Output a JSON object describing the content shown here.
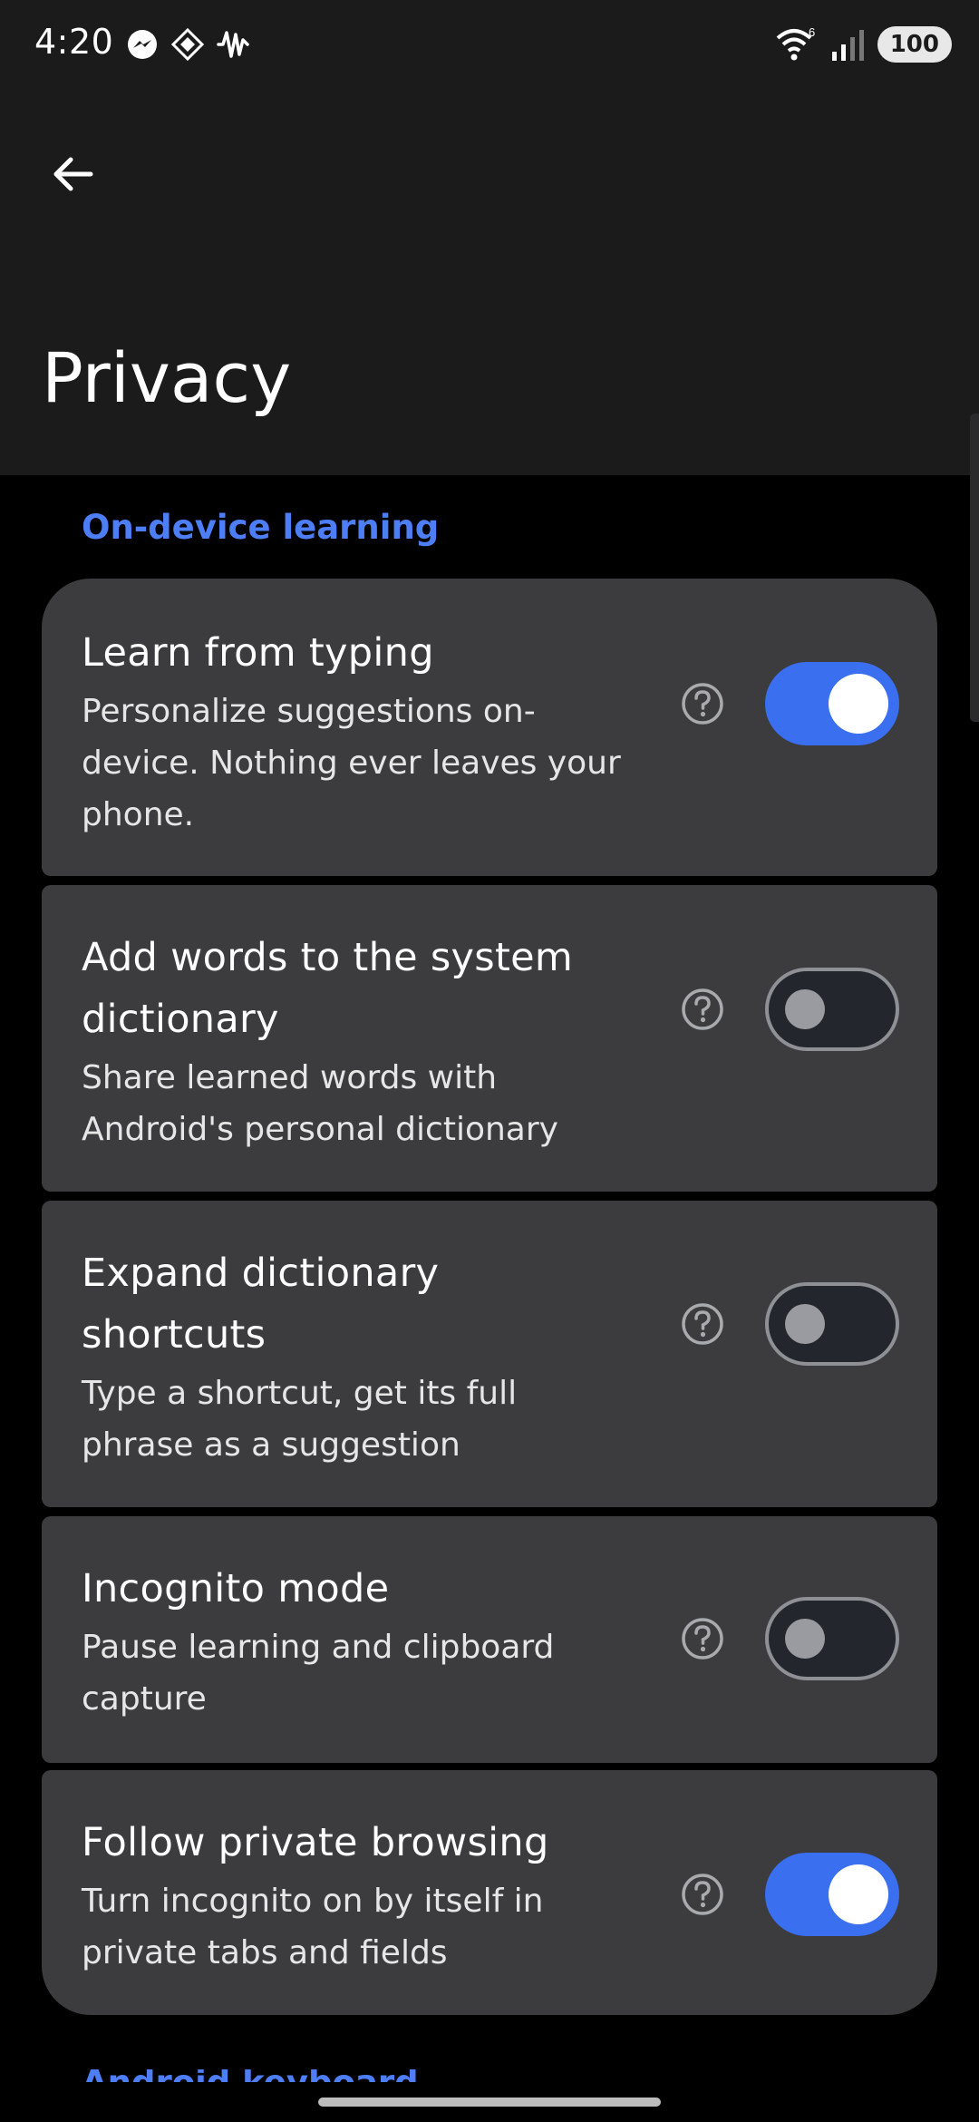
{
  "status_bar": {
    "time": "4:20",
    "left_icons": [
      "messenger-icon",
      "sparkle-app-icon",
      "waveform-icon"
    ],
    "right_icons": [
      "wifi-6-icon",
      "signal-icon"
    ],
    "battery": "100"
  },
  "header": {
    "back_icon": "arrow-left-icon",
    "title": "Privacy"
  },
  "section": {
    "title": "On-device learning"
  },
  "settings": [
    {
      "title": "Learn from typing",
      "summary": "Personalize suggestions on-device. Nothing ever leaves your phone.",
      "enabled": true
    },
    {
      "title": "Add words to the system dictionary",
      "summary": "Share learned words with Android's personal dictionary",
      "enabled": false
    },
    {
      "title": "Expand dictionary shortcuts",
      "summary": "Type a shortcut, get its full phrase as a suggestion",
      "enabled": false
    },
    {
      "title": "Incognito mode",
      "summary": "Pause learning and clipboard capture",
      "enabled": false
    },
    {
      "title": "Follow private browsing",
      "summary": "Turn incognito on by itself in private tabs and fields",
      "enabled": true
    }
  ],
  "next_section": {
    "title": "Android keyboard"
  },
  "colors": {
    "accent": "#4d7ef5",
    "toggle_on": "#3a6ff0",
    "card_bg": "#3c3c3f",
    "header_bg": "#1b1b1c",
    "page_bg": "#000000"
  }
}
